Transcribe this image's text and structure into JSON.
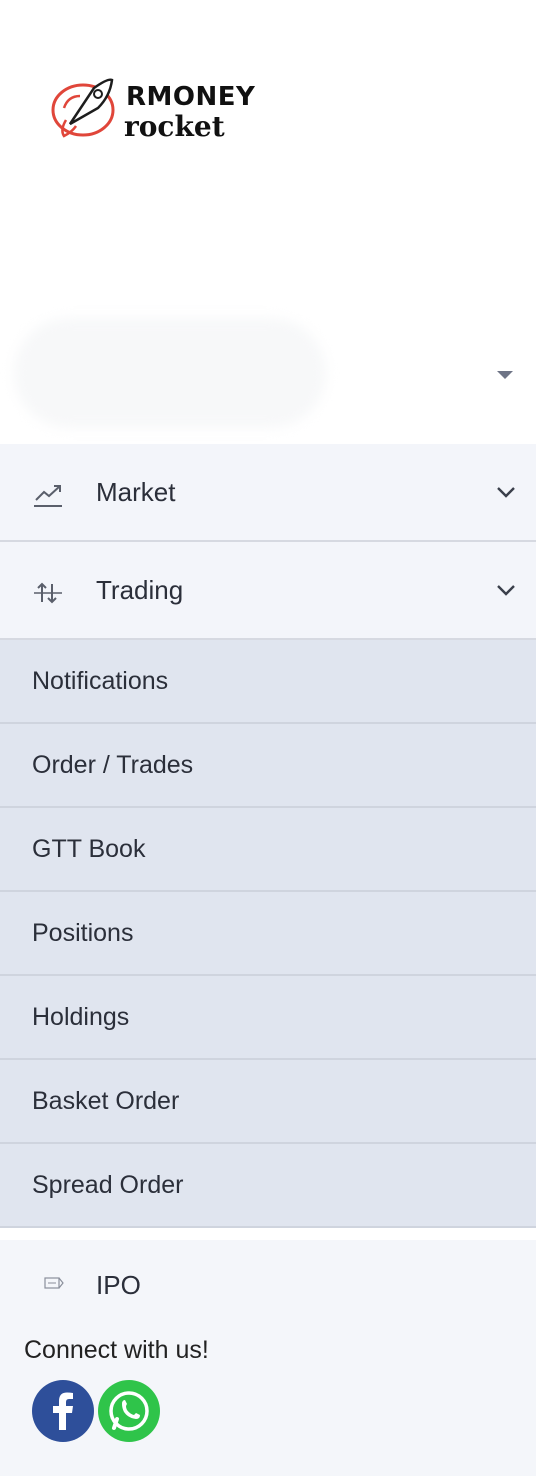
{
  "brand": {
    "line1": "RMONEY",
    "line2": "rocket",
    "accent_color": "#e0463a"
  },
  "menu": {
    "groups": [
      {
        "label": "Market",
        "icon": "trend-up-icon"
      },
      {
        "label": "Trading",
        "icon": "trading-arrows-icon"
      }
    ],
    "items": [
      {
        "label": "Notifications"
      },
      {
        "label": "Order / Trades"
      },
      {
        "label": "GTT Book"
      },
      {
        "label": "Positions"
      },
      {
        "label": "Holdings"
      },
      {
        "label": "Basket Order"
      },
      {
        "label": "Spread Order"
      }
    ],
    "ipo": {
      "label": "IPO",
      "icon": "ipo-tag-icon"
    }
  },
  "footer": {
    "connect_label": "Connect with us!",
    "social": [
      {
        "name": "facebook",
        "color": "#2e4f9a"
      },
      {
        "name": "whatsapp",
        "color": "#2fc44a"
      }
    ]
  }
}
